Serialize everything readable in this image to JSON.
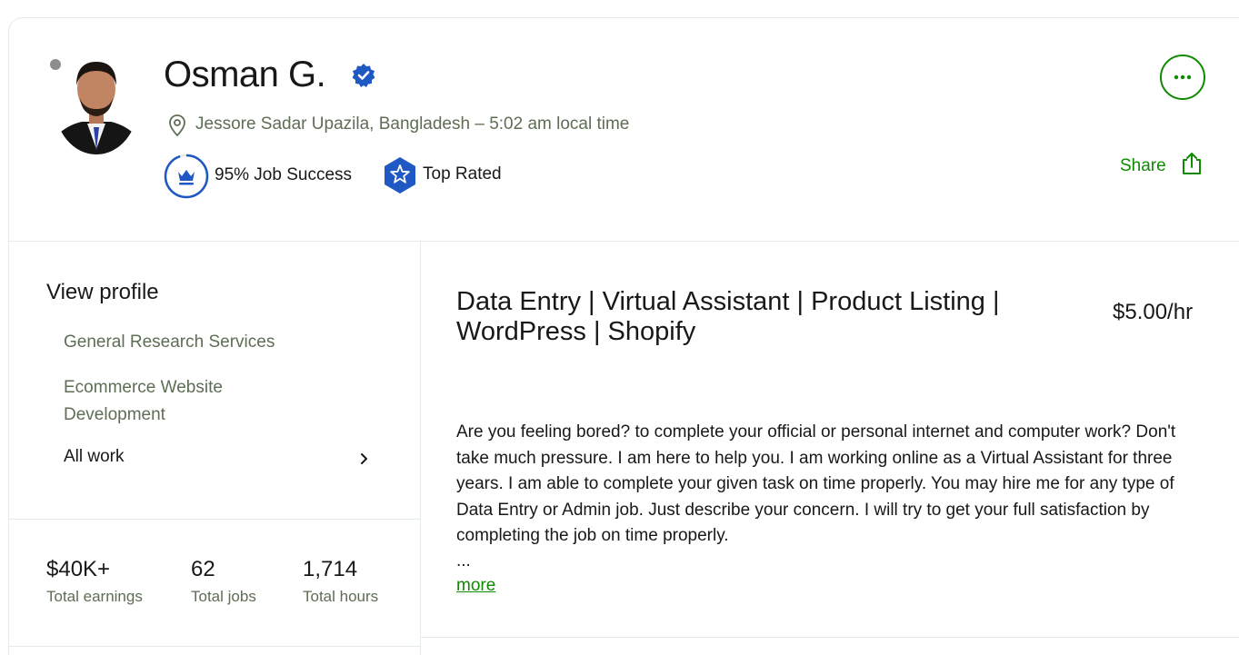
{
  "profile": {
    "name": "Osman G.",
    "location": "Jessore Sadar Upazila, Bangladesh – 5:02 am local time",
    "job_success": "95% Job Success",
    "job_success_percent": 95,
    "badge": "Top Rated",
    "share_label": "Share"
  },
  "sidebar": {
    "heading": "View profile",
    "items": [
      {
        "label": "General Research Services"
      },
      {
        "label": "Ecommerce Website Development"
      }
    ],
    "all_work_label": "All work"
  },
  "stats": [
    {
      "value": "$40K+",
      "label": "Total earnings"
    },
    {
      "value": "62",
      "label": "Total jobs"
    },
    {
      "value": "1,714",
      "label": "Total hours"
    }
  ],
  "main": {
    "title": "Data Entry | Virtual Assistant | Product Listing | WordPress | Shopify",
    "rate": "$5.00/hr",
    "description": "Are you feeling bored? to complete your official or personal internet and computer work? Don't take much pressure. I am here to help you. I am working online as a Virtual Assistant for three years. I am able to complete your given task on time properly. You may hire me for any type of Data Entry or Admin job. Just describe your concern. I will try to get your full satisfaction by completing the job on time properly.",
    "ellipsis": "...",
    "more_label": "more"
  },
  "icons": {
    "verified": "verified-check-icon",
    "location": "location-pin-icon",
    "job_success": "crown-icon",
    "top_rated": "star-badge-icon",
    "more": "ellipsis-icon",
    "share": "share-icon",
    "chevron": "chevron-right-icon"
  },
  "colors": {
    "brand_green": "#108a00",
    "verified_blue": "#1f57c3",
    "muted_text": "#5e6d55",
    "status_offline": "#8d8d8d"
  }
}
